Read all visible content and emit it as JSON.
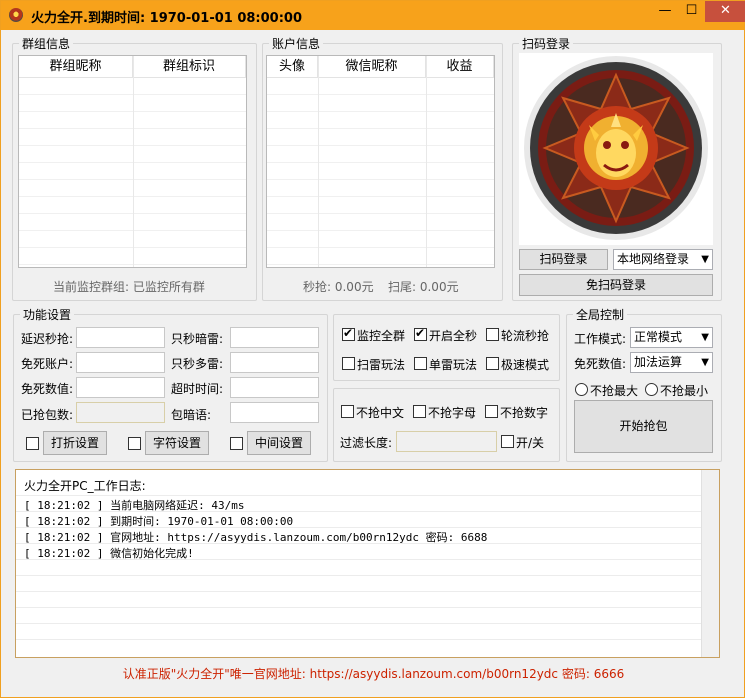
{
  "titlebar": {
    "title": "火力全开.到期时间: 1970-01-01 08:00:00",
    "min": "—",
    "max": "☐",
    "close": "✕"
  },
  "group_info": {
    "title": "群组信息",
    "columns": [
      "群组昵称",
      "群组标识"
    ],
    "status": "当前监控群组: 已监控所有群"
  },
  "account_info": {
    "title": "账户信息",
    "columns": [
      "头像",
      "微信昵称",
      "收益"
    ],
    "status_grab": "秒抢: 0.00元",
    "status_tail": "扫尾: 0.00元"
  },
  "scan_login": {
    "title": "扫码登录",
    "scan_button": "扫码登录",
    "mode_select": "本地网络登录",
    "no_scan_button": "免扫码登录"
  },
  "func_settings": {
    "title": "功能设置",
    "labels": [
      "延迟秒抢:",
      "免死账户:",
      "免死数值:",
      "已抢包数:",
      "只秒暗雷:",
      "只秒多雷:",
      "超时时间:",
      "包暗语:"
    ],
    "sub_buttons": [
      "打折设置",
      "字符设置",
      "中间设置"
    ]
  },
  "options": {
    "row1": [
      "监控全群",
      "开启全秒",
      "轮流秒抢"
    ],
    "row2": [
      "扫雷玩法",
      "单雷玩法",
      "极速模式"
    ],
    "row3": [
      "不抢中文",
      "不抢字母",
      "不抢数字"
    ],
    "filter_label": "过滤长度:",
    "toggle_label": "开/关"
  },
  "global": {
    "title": "全局控制",
    "work_mode_label": "工作模式:",
    "work_mode": "正常模式",
    "exempt_label": "免死数值:",
    "exempt_mode": "加法运算",
    "radio1": "不抢最大",
    "radio2": "不抢最小",
    "start_button": "开始抢包"
  },
  "log": {
    "title": "火力全开PC_工作日志:",
    "lines": [
      "[ 18:21:02 ] 当前电脑网络延迟: 43/ms",
      "[ 18:21:02 ] 到期时间: 1970-01-01 08:00:00",
      "[ 18:21:02 ] 官网地址: https://asyydis.lanzoum.com/b00rn12ydc 密码: 6688",
      "[ 18:21:02 ] 微信初始化完成!"
    ]
  },
  "footer": "认准正版\"火力全开\"唯一官网地址: https://asyydis.lanzoum.com/b00rn12ydc 密码: 6666"
}
